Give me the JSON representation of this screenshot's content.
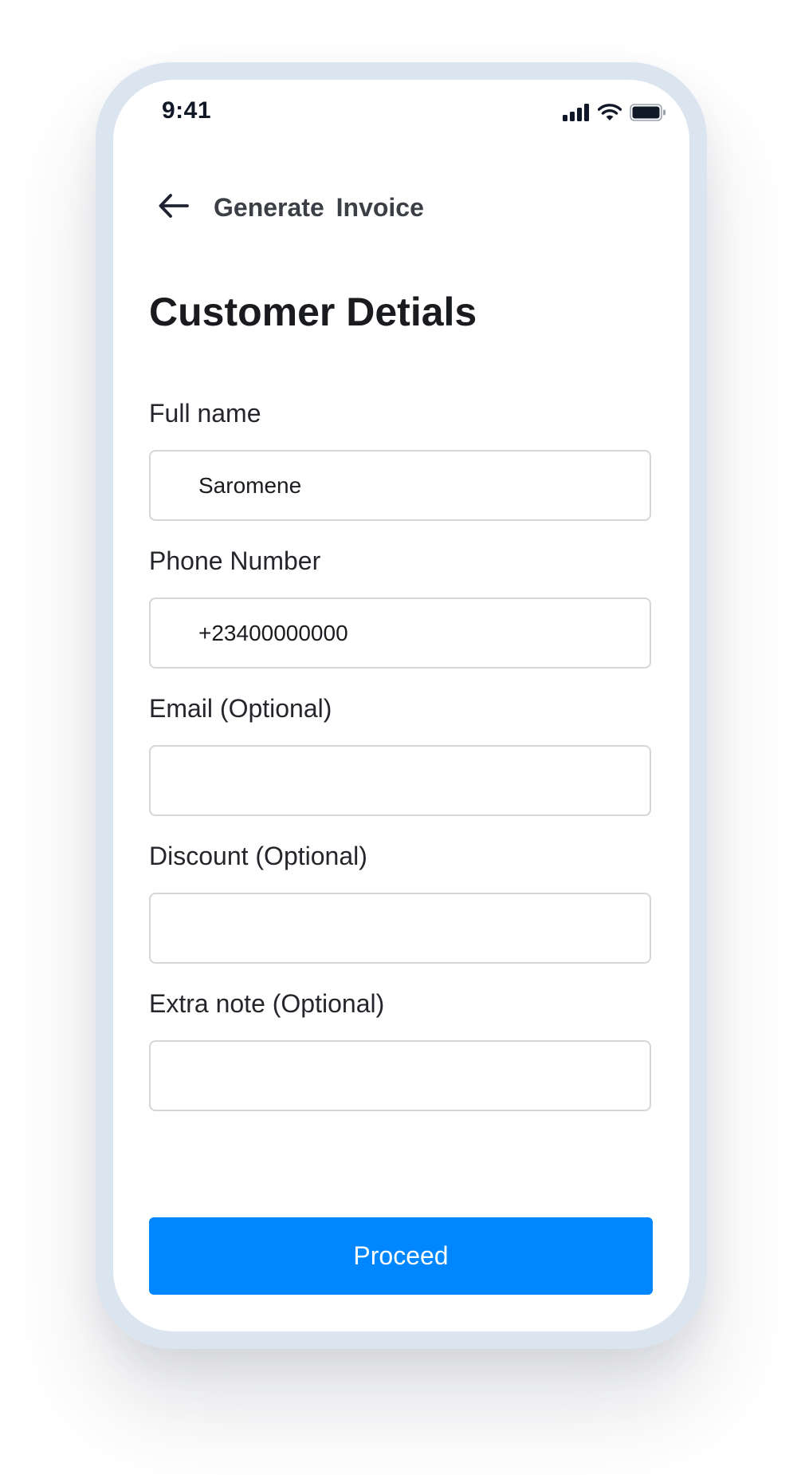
{
  "status_bar": {
    "time": "9:41",
    "icons": [
      "signal-icon",
      "wifi-icon",
      "battery-icon"
    ]
  },
  "nav": {
    "back_icon": "arrow-left-icon",
    "title": "Generate  Invoice"
  },
  "page_title": "Customer Detials",
  "form": {
    "full_name": {
      "label": "Full name",
      "value": "Saromene"
    },
    "phone": {
      "label": "Phone Number",
      "value": "+23400000000"
    },
    "email": {
      "label": "Email (Optional)",
      "value": ""
    },
    "discount": {
      "label": "Discount (Optional)",
      "value": ""
    },
    "extra_note": {
      "label": "Extra note (Optional)",
      "value": ""
    }
  },
  "proceed": {
    "label": "Proceed"
  },
  "colors": {
    "accent": "#0086FF",
    "device_frame": "#DBE5F0",
    "input_border": "#D4D6DA",
    "text_primary": "#1A1B1F"
  }
}
